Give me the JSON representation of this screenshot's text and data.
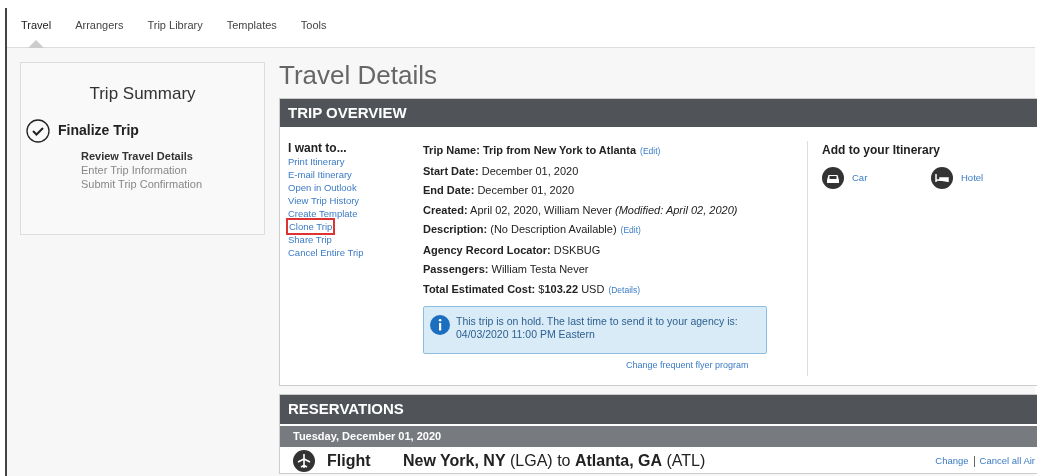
{
  "tabs": [
    {
      "label": "Travel",
      "selected": true
    },
    {
      "label": "Arrangers",
      "selected": false
    },
    {
      "label": "Trip Library",
      "selected": false
    },
    {
      "label": "Templates",
      "selected": false
    },
    {
      "label": "Tools",
      "selected": false
    }
  ],
  "summary": {
    "title": "Trip Summary",
    "stage": "Finalize Trip",
    "steps": [
      {
        "label": "Review Travel Details",
        "current": true
      },
      {
        "label": "Enter Trip Information",
        "current": false
      },
      {
        "label": "Submit Trip Confirmation",
        "current": false
      }
    ]
  },
  "page_title": "Travel Details",
  "overview": {
    "title": "TRIP OVERVIEW",
    "actions_title": "I want to...",
    "actions": [
      {
        "label": "Print Itinerary",
        "highlighted": false
      },
      {
        "label": "E-mail Itinerary",
        "highlighted": false
      },
      {
        "label": "Open in Outlook",
        "highlighted": false
      },
      {
        "label": "View Trip History",
        "highlighted": false
      },
      {
        "label": "Create Template",
        "highlighted": false
      },
      {
        "label": "Clone Trip",
        "highlighted": true
      },
      {
        "label": "Share Trip",
        "highlighted": false
      },
      {
        "label": "Cancel Entire Trip",
        "highlighted": false
      }
    ],
    "details": [
      {
        "text": "**Trip Name: Trip from New York to Atlanta**",
        "link": "(Edit)"
      },
      {
        "text": "**Start Date:** December 01, 2020"
      },
      {
        "text": "**End Date:** December 01, 2020"
      },
      {
        "text": "**Created:** April 02, 2020, William Never *(Modified: April 02, 2020)*"
      },
      {
        "text": "**Description:** (No Description Available)",
        "link": "(Edit)"
      },
      {
        "text": "**Agency Record Locator:** DSKBUG"
      },
      {
        "text": "**Passengers:** William Testa Never"
      },
      {
        "text": "**Total Estimated Cost:** $**103.22** USD",
        "link": "(Details)"
      }
    ],
    "notice": "This trip is on hold. The last time to send it to your agency is: 04/03/2020 11:00 PM Eastern",
    "notice_link": "Change frequent flyer program",
    "add_title": "Add to your Itinerary",
    "add_items": [
      {
        "kind": "car",
        "label": "Car"
      },
      {
        "kind": "hotel",
        "label": "Hotel"
      }
    ]
  },
  "reservations": {
    "title": "RESERVATIONS",
    "date": "Tuesday, December 01, 2020",
    "segment": {
      "kind": "flight",
      "type": "Flight",
      "route": "**New York, NY** (LGA) to **Atlanta, GA** (ATL)",
      "actions": [
        "Change",
        "Cancel all Air"
      ]
    }
  }
}
